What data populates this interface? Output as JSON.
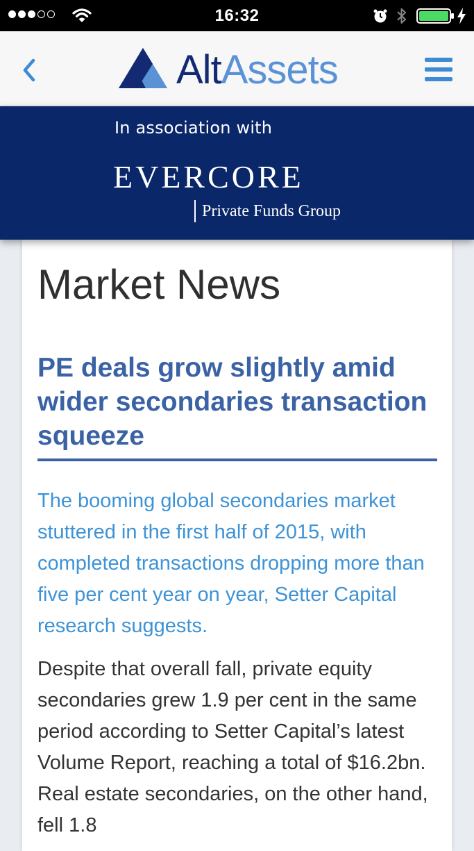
{
  "status_bar": {
    "time": "16:32",
    "signal": {
      "filled": 3,
      "total": 5
    }
  },
  "nav": {
    "logo": {
      "part1": "Alt",
      "part2": "Assets"
    },
    "back_icon": "chevron-left-icon",
    "menu_icon": "hamburger-menu-icon"
  },
  "banner": {
    "association": "In association with",
    "sponsor_name": "Evercore",
    "sponsor_sub": "Private Funds Group"
  },
  "article": {
    "section": "Market News",
    "headline": "PE deals grow slightly amid wider secondaries transaction squeeze",
    "standfirst": "The booming global secondaries market stuttered in the first half of 2015, with completed transactions dropping more than five per cent year on year, Setter Capital research suggests.",
    "body": "Despite that overall fall, private equity secondaries grew 1.9 per cent in the same period according to Setter Capital’s latest Volume Report, reaching a total of $16.2bn. Real estate secondaries, on the other hand, fell 1.8"
  },
  "colors": {
    "banner_bg": "#0a2769",
    "headline": "#3a62a5",
    "standfirst": "#3d93d6",
    "accent": "#3d8bd4"
  }
}
